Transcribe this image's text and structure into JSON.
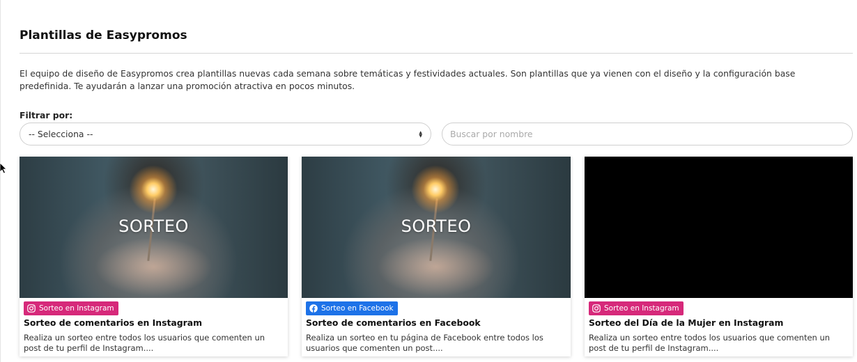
{
  "page": {
    "title": "Plantillas de Easypromos",
    "description": "El equipo de diseño de Easypromos crea plantillas nuevas cada semana sobre temáticas y festividades actuales. Son plantillas que ya vienen con el diseño y la configuración base predefinida. Te ayudarán a lanzar una promoción atractiva en pocos minutos."
  },
  "filter": {
    "label": "Filtrar por:",
    "select_value": "-- Selecciona --",
    "search_placeholder": "Buscar por nombre"
  },
  "cards": [
    {
      "thumb_text": "SORTEO",
      "badge": "Sorteo en Instagram",
      "badge_icon": "instagram-icon",
      "badge_color": "#d6297a",
      "title": "Sorteo de comentarios en Instagram",
      "description": "Realiza un sorteo entre todos los usuarios que comenten un post de tu perfil de Instagram...."
    },
    {
      "thumb_text": "SORTEO",
      "badge": "Sorteo en Facebook",
      "badge_icon": "facebook-icon",
      "badge_color": "#1d72e8",
      "title": "Sorteo de comentarios en Facebook",
      "description": "Realiza un sorteo en tu página de Facebook entre todos los usuarios que comenten un post...."
    },
    {
      "thumb_text": "",
      "badge": "Sorteo en Instagram",
      "badge_icon": "instagram-icon",
      "badge_color": "#d6297a",
      "title": "Sorteo del Día de la Mujer en Instagram",
      "description": "Realiza un sorteo entre todos los usuarios que comenten un post de tu perfil de Instagram...."
    }
  ]
}
